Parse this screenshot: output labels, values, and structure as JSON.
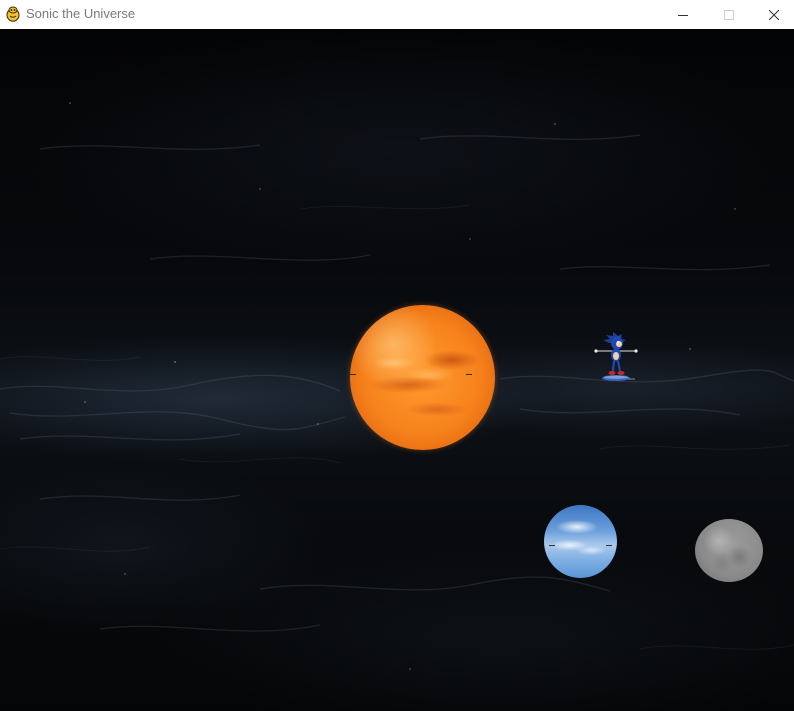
{
  "window": {
    "title": "Sonic the Universe",
    "controls": {
      "minimize_icon": "minimize-icon",
      "maximize_icon": "maximize-icon",
      "close_icon": "close-icon"
    }
  },
  "scene": {
    "background_color": "#000000",
    "bodies": [
      {
        "name": "sun",
        "icon": "sun-planet",
        "color": "#f7821c"
      },
      {
        "name": "earth",
        "icon": "earth-planet",
        "color": "#6a9fdc"
      },
      {
        "name": "moon",
        "icon": "moon-planet",
        "color": "#8a8a8a"
      }
    ],
    "player": {
      "character": "sonic",
      "icon": "sonic-sprite",
      "color": "#1d3f9e"
    }
  }
}
